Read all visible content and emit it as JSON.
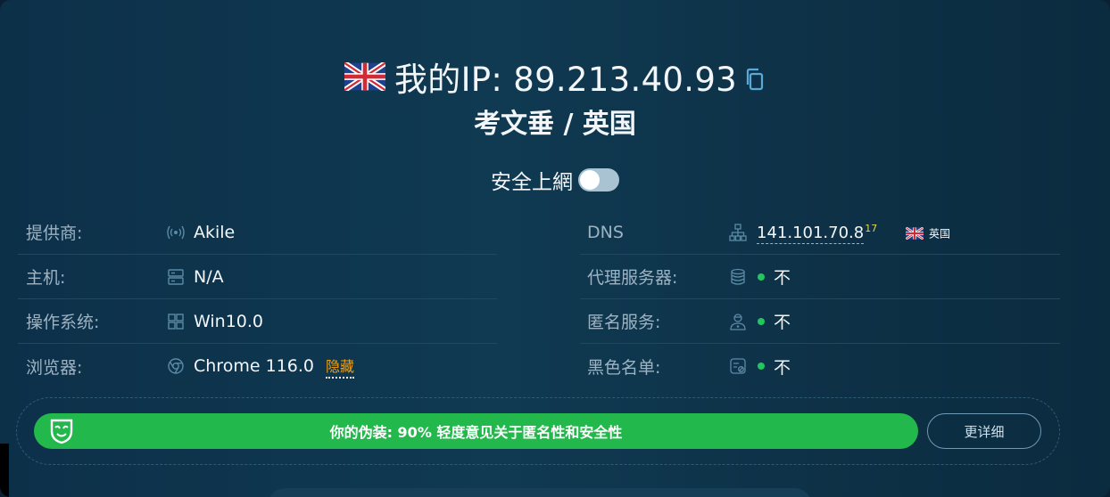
{
  "header": {
    "ip_label": "我的IP: 89.213.40.93",
    "location": "考文垂 / 英国",
    "secure_label": "安全上網",
    "secure_enabled": false
  },
  "left_rows": [
    {
      "label": "提供商:",
      "value": "Akile",
      "icon": "signal-icon"
    },
    {
      "label": "主机:",
      "value": "N/A",
      "icon": "server-icon"
    },
    {
      "label": "操作系统:",
      "value": "Win10.0",
      "icon": "windows-icon"
    },
    {
      "label": "浏览器:",
      "value": "Chrome 116.0",
      "icon": "chrome-icon",
      "extra": "隐藏"
    }
  ],
  "right_rows": [
    {
      "label": "DNS",
      "value": "141.101.70.8",
      "sup": "17",
      "country": "英国",
      "icon": "network-icon"
    },
    {
      "label": "代理服务器:",
      "value": "不",
      "icon": "database-icon"
    },
    {
      "label": "匿名服务:",
      "value": "不",
      "icon": "user-shield-icon"
    },
    {
      "label": "黑色名单:",
      "value": "不",
      "icon": "blacklist-icon"
    }
  ],
  "disguise": {
    "text": "你的伪装: 90% 轻度意见关于匿名性和安全性",
    "button": "更详细"
  },
  "colors": {
    "accent_green": "#22b84b",
    "status_green": "#22c55e",
    "warning_orange": "#f59e0b"
  }
}
